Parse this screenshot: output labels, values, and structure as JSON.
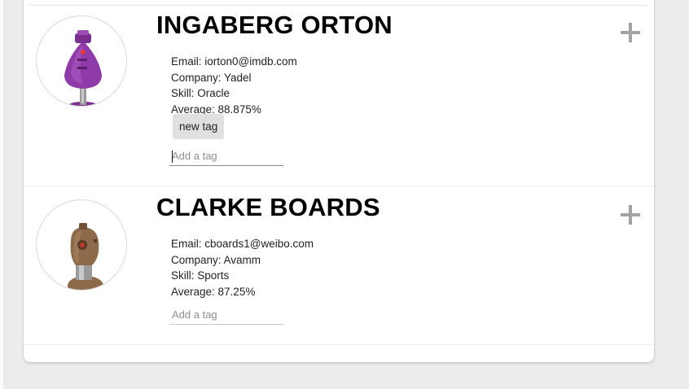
{
  "students": [
    {
      "name": "INGABERG ORTON",
      "email": "Email: iorton0@imdb.com",
      "company": "Company: Yadel",
      "skill": "Skill: Oracle",
      "average": "Average: 88.875%",
      "tags": [
        "new tag"
      ],
      "tag_placeholder": "Add a tag",
      "avatar_icon": "purple-robot-avatar-icon",
      "avatar_color": "#8e3aa8"
    },
    {
      "name": "CLARKE BOARDS",
      "email": "Email: cboards1@weibo.com",
      "company": "Company: Avamm",
      "skill": "Skill: Sports",
      "average": "Average: 87.25%",
      "tags": [],
      "tag_placeholder": "Add a tag",
      "avatar_icon": "brown-robot-avatar-icon",
      "avatar_color": "#8c6a4a"
    }
  ],
  "icons": {
    "expand": "plus-icon"
  },
  "colors": {
    "background": "#ececec",
    "card": "#ffffff",
    "tag_bg": "#e0e0e0",
    "plus": "#a3a3a3"
  }
}
